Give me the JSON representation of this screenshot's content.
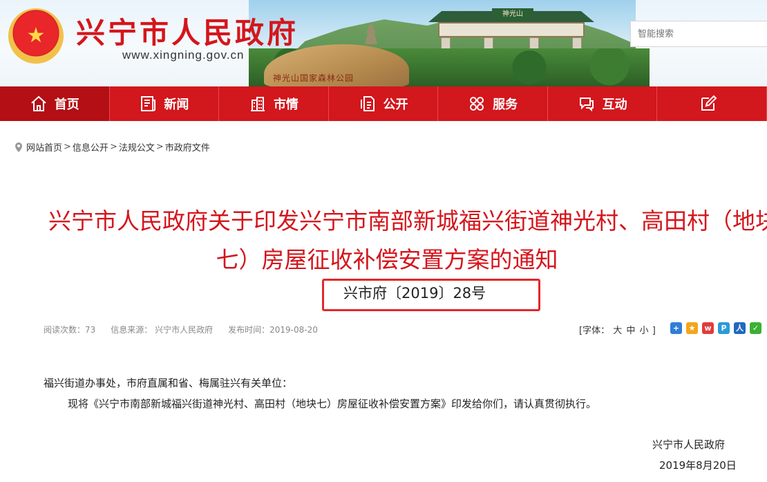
{
  "header": {
    "site_name": "兴宁市人民政府",
    "site_url": "www.xingning.gov.cn",
    "banner_rock_text": "神光山国家森林公园",
    "banner_gate_text": "神光山",
    "search_placeholder": "智能搜索"
  },
  "nav": [
    {
      "label": "首页",
      "icon": "home-icon"
    },
    {
      "label": "新闻",
      "icon": "news-icon"
    },
    {
      "label": "市情",
      "icon": "city-icon"
    },
    {
      "label": "公开",
      "icon": "document-icon"
    },
    {
      "label": "服务",
      "icon": "service-grid-icon"
    },
    {
      "label": "互动",
      "icon": "chat-icon"
    },
    {
      "label": "",
      "icon": "edit-icon"
    }
  ],
  "breadcrumb": {
    "items": [
      "网站首页",
      "信息公开",
      "法规公文",
      "市政府文件"
    ],
    "separator": ">"
  },
  "article": {
    "title_line1": "兴宁市人民政府关于印发兴宁市南部新城福兴街道神光村、高田村（地块",
    "title_line2": "七）房屋征收补偿安置方案的通知",
    "doc_number": "兴市府〔2019〕28号",
    "meta": {
      "views": "阅读次数：73",
      "source": "信息来源： 兴宁市人民政府",
      "publish_time": "发布时间：2019-08-20"
    },
    "font_size": {
      "prefix": "[字体：",
      "large": "大",
      "medium": "中",
      "small": "小",
      "suffix": "]"
    },
    "share_icons": [
      {
        "name": "share-plus-icon",
        "glyph": "+",
        "color": "#2f7fd6"
      },
      {
        "name": "qzone-icon",
        "glyph": "★",
        "color": "#f3a51b"
      },
      {
        "name": "weibo-icon",
        "glyph": "w",
        "color": "#e23b3b"
      },
      {
        "name": "tencent-weibo-icon",
        "glyph": "P",
        "color": "#2b9bd8"
      },
      {
        "name": "renren-icon",
        "glyph": "人",
        "color": "#2168c2"
      },
      {
        "name": "wechat-icon",
        "glyph": "✓",
        "color": "#3cb035"
      }
    ],
    "salutation": "福兴街道办事处，市府直属和省、梅属驻兴有关单位：",
    "paragraph": "现将《兴宁市南部新城福兴街道神光村、高田村（地块七）房屋征收补偿安置方案》印发给你们，请认真贯彻执行。",
    "signoff": "兴宁市人民政府",
    "date": "2019年8月20日"
  },
  "colors": {
    "brand_red": "#d4161c",
    "nav_red": "#d2171d",
    "highlight_box": "#e3272b"
  }
}
